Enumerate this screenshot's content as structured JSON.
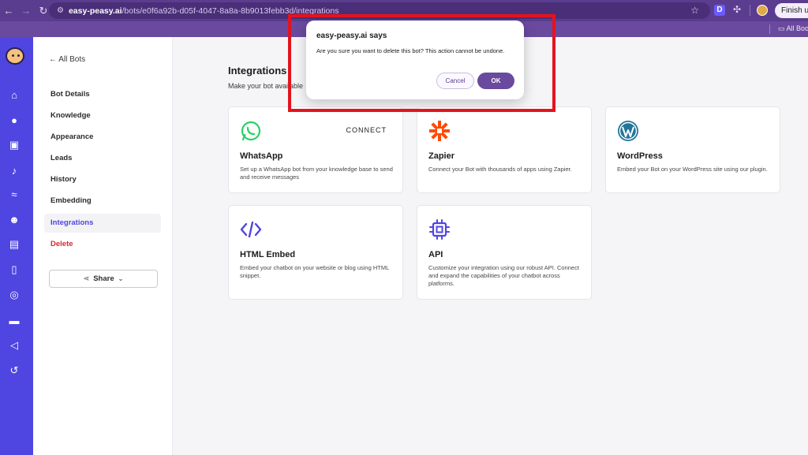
{
  "browser": {
    "url_host": "easy-peasy.ai",
    "url_path": "/bots/e0f6a92b-d05f-4047-8a8a-8b9013febb3d/integrations",
    "extension_letter": "D",
    "finish_label": "Finish upd",
    "bookmark_folder": "All Boo"
  },
  "sidebar_nav": {
    "back_label": "← All Bots",
    "items": [
      {
        "label": "Bot Details"
      },
      {
        "label": "Knowledge"
      },
      {
        "label": "Appearance"
      },
      {
        "label": "Leads"
      },
      {
        "label": "History"
      },
      {
        "label": "Embedding"
      },
      {
        "label": "Integrations"
      },
      {
        "label": "Delete"
      }
    ],
    "share_label": "Share"
  },
  "main": {
    "title": "Integrations",
    "subtitle": "Make your bot available",
    "cards": [
      {
        "title": "WhatsApp",
        "desc": "Set up a WhatsApp bot from your knowledge base to send and receive messages",
        "action": "CONNECT",
        "icon": "whatsapp-icon"
      },
      {
        "title": "Zapier",
        "desc": "Connect your Bot with thousands of apps using Zapier.",
        "icon": "zapier-icon"
      },
      {
        "title": "WordPress",
        "desc": "Embed your Bot on your WordPress site using our plugin.",
        "icon": "wordpress-icon"
      },
      {
        "title": "HTML Embed",
        "desc": "Embed your chatbot on your website or blog using HTML snippet.",
        "icon": "code-icon"
      },
      {
        "title": "API",
        "desc": "Customize your integration using our robust API. Connect and expand the capabilities of your chatbot across platforms.",
        "icon": "chip-icon"
      }
    ]
  },
  "dialog": {
    "title": "easy-peasy.ai says",
    "message": "Are you sure you want to delete this bot? This action cannot be undone.",
    "cancel_label": "Cancel",
    "ok_label": "OK"
  },
  "colors": {
    "browser_bar": "#5b3d8f",
    "rail": "#4f45e0",
    "active_nav": "#4f45e0",
    "danger": "#d9272e",
    "ok_button": "#6a4a9e",
    "highlight_box": "#e3141e"
  }
}
